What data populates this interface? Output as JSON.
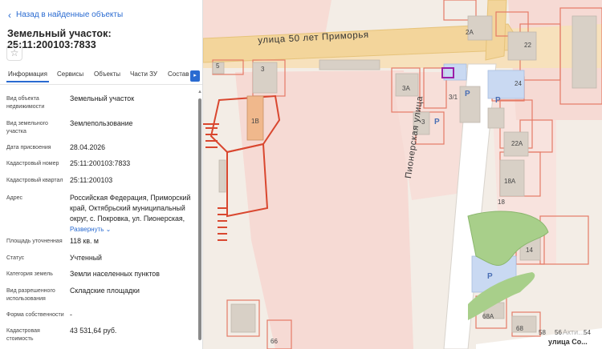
{
  "panel": {
    "back_label": "Назад в найденные объекты",
    "title": "Земельный участок: 25:11:200103:7833",
    "tabs": [
      "Информация",
      "Сервисы",
      "Объекты",
      "Части ЗУ",
      "Состав"
    ],
    "active_tab": "Информация",
    "rows": [
      {
        "label": "Вид объекта недвижимости",
        "value": "Земельный участок"
      },
      {
        "label": "Вид земельного участка",
        "value": "Землепользование"
      },
      {
        "label": "Дата присвоения",
        "value": "28.04.2026"
      },
      {
        "label": "Кадастровый номер",
        "value": "25:11:200103:7833"
      },
      {
        "label": "Кадастровый квартал",
        "value": "25:11:200103"
      },
      {
        "label": "Адрес",
        "value": "Российская Федерация, Приморский край, Октябрьский муниципальный округ, с. Покровка, ул. Пионерская,",
        "expand": "Развернуть"
      },
      {
        "label": "Площадь уточненная",
        "value": "118 кв. м"
      },
      {
        "label": "Статус",
        "value": "Учтенный"
      },
      {
        "label": "Категория земель",
        "value": "Земли населенных пунктов"
      },
      {
        "label": "Вид разрешенного использования",
        "value": "Складские площадки"
      },
      {
        "label": "Форма собственности",
        "value": "-"
      },
      {
        "label": "Кадастровая стоимость",
        "value": "43 531,64 руб."
      }
    ]
  },
  "map": {
    "street_top": "улица 50 лет Приморья",
    "street_vertical": "Пионерская улица",
    "street_bottom": "улица Со...",
    "labels": [
      "5",
      "3",
      "2А",
      "22",
      "3А",
      "3/1",
      "24",
      "1В",
      "3",
      "22А",
      "18А",
      "18",
      "14",
      "68А",
      "68",
      "58",
      "56",
      "54",
      "66"
    ],
    "watermark": "Акти..."
  }
}
